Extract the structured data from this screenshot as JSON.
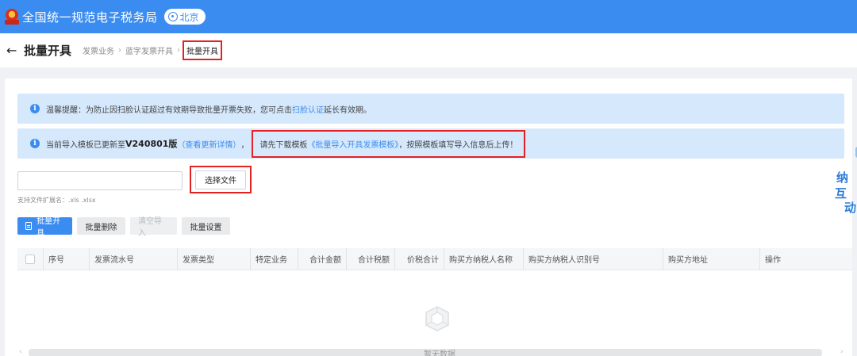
{
  "topbar": {
    "title": "全国统一规范电子税务局",
    "city": "北京"
  },
  "header": {
    "back_icon": "←",
    "title": "批量开具",
    "breadcrumb": [
      "发票业务",
      "蓝字发票开具",
      "批量开具"
    ],
    "breadcrumb_sep": "›"
  },
  "alerts": {
    "a1_text1": "温馨提醒：为防止因扫脸认证超过有效期导致批量开票失败，您可点击",
    "a1_link": "扫脸认证",
    "a1_text2": "延长有效期。",
    "a2_text1": "当前导入模板已更新至",
    "a2_version": "V240801版",
    "a2_details": "（查看更新详情）",
    "a2_text2": "，",
    "a2_text3": "请先下载模板",
    "a2_template": "《批量导入开具发票模板》",
    "a2_text4": "，按照模板填写导入信息后上传！"
  },
  "upload": {
    "choose_label": "选择文件",
    "hint": "支持文件扩展名：.xls .xlsx"
  },
  "toolbar": {
    "batch_issue": "批量开具",
    "batch_delete": "批量删除",
    "clear_import": "清空导入",
    "batch_settings": "批量设置"
  },
  "table": {
    "headers": [
      "序号",
      "发票流水号",
      "发票类型",
      "特定业务",
      "合计金额",
      "合计税额",
      "价税合计",
      "购买方纳税人名称",
      "购买方纳税人识别号",
      "购买方地址",
      "操作"
    ],
    "empty_text": "暂无数据"
  },
  "side_widget": {
    "chars": [
      "纳",
      "互",
      "动"
    ]
  },
  "colors": {
    "primary": "#3b8cf0",
    "highlight": "#e52222",
    "alert_bg": "#d5e8fc"
  }
}
